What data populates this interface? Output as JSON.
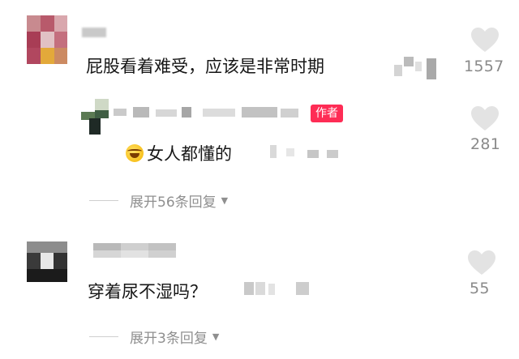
{
  "comments": [
    {
      "text": "屁股看着难受，应该是非常时期",
      "likes": "1557",
      "replies": [
        {
          "author_badge": "作者",
          "text": "女人都懂的",
          "likes": "281"
        }
      ],
      "expand_label": "展开56条回复"
    },
    {
      "text": "穿着尿不湿吗？",
      "likes": "55",
      "expand_label": "展开3条回复"
    }
  ],
  "icons": {
    "like": "heart-icon",
    "expand": "caret-down-icon",
    "reply_emoji": "laughing-crying-emoji"
  },
  "colors": {
    "badge": "#fe2c55",
    "meta_text": "#8a8a8a",
    "heart": "#e3e3e3"
  }
}
